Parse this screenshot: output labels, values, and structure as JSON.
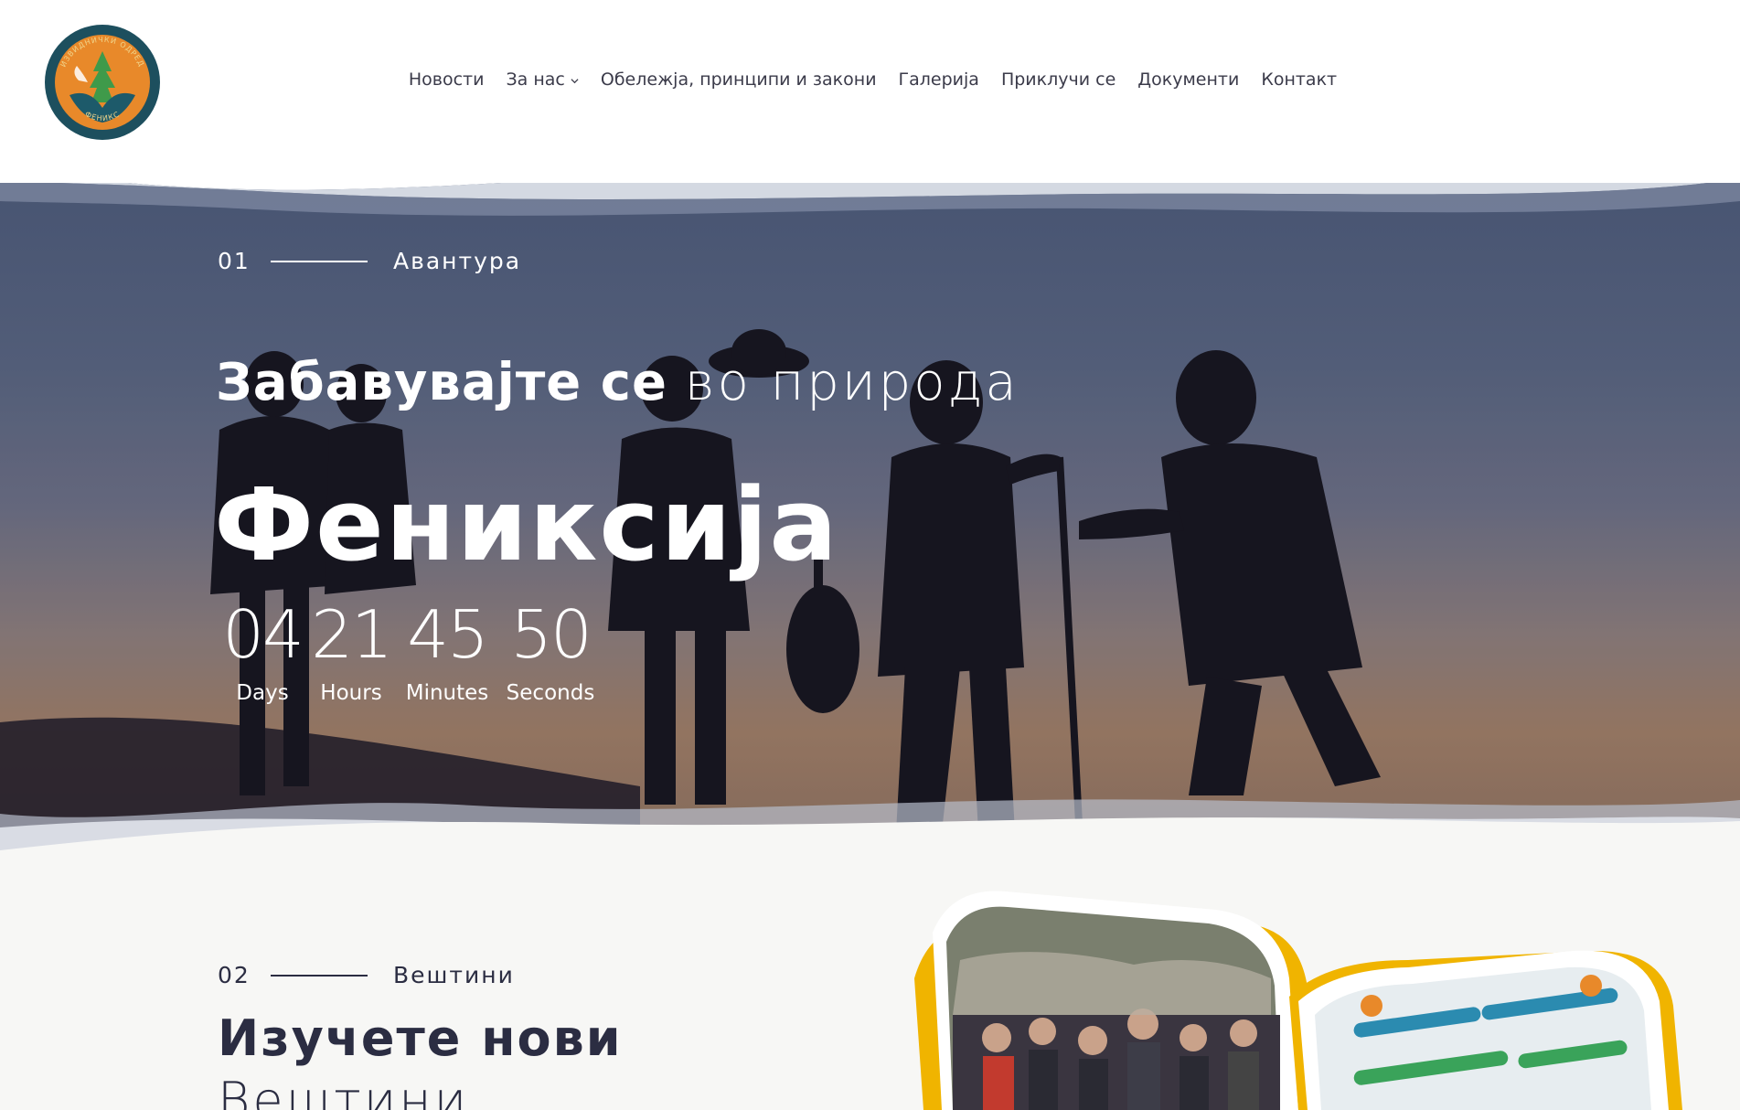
{
  "brand": {
    "logo_top_text": "ИЗВИДНИЧКИ ОДРЕД",
    "logo_bottom_text": "ФЕНИКС",
    "colors": {
      "teal": "#1d5a6a",
      "orange": "#e8892a",
      "green": "#3f9a4a"
    }
  },
  "nav": {
    "items": [
      {
        "label": "Новости"
      },
      {
        "label": "За нас",
        "has_dropdown": true
      },
      {
        "label": "Обележја, принципи и закони"
      },
      {
        "label": "Галерија"
      },
      {
        "label": "Приклучи се"
      },
      {
        "label": "Документи"
      },
      {
        "label": "Контакт"
      }
    ]
  },
  "hero": {
    "step_number": "01",
    "step_label": "Авантура",
    "headline_bold": "Забавувајте се",
    "headline_light": "во природа",
    "title": "Фениксија",
    "countdown": [
      {
        "value": "04",
        "label": "Days"
      },
      {
        "value": "21",
        "label": "Hours"
      },
      {
        "value": "45",
        "label": "Minutes"
      },
      {
        "value": "50",
        "label": "Seconds"
      }
    ]
  },
  "section2": {
    "step_number": "02",
    "step_label": "Вештини",
    "title": "Изучете нови",
    "subtitle": "Вештини"
  },
  "colors": {
    "text_dark": "#2b2d42",
    "nav_text": "#3b3b4a",
    "accent_yellow": "#f0b400",
    "section_bg": "#f7f7f5"
  }
}
